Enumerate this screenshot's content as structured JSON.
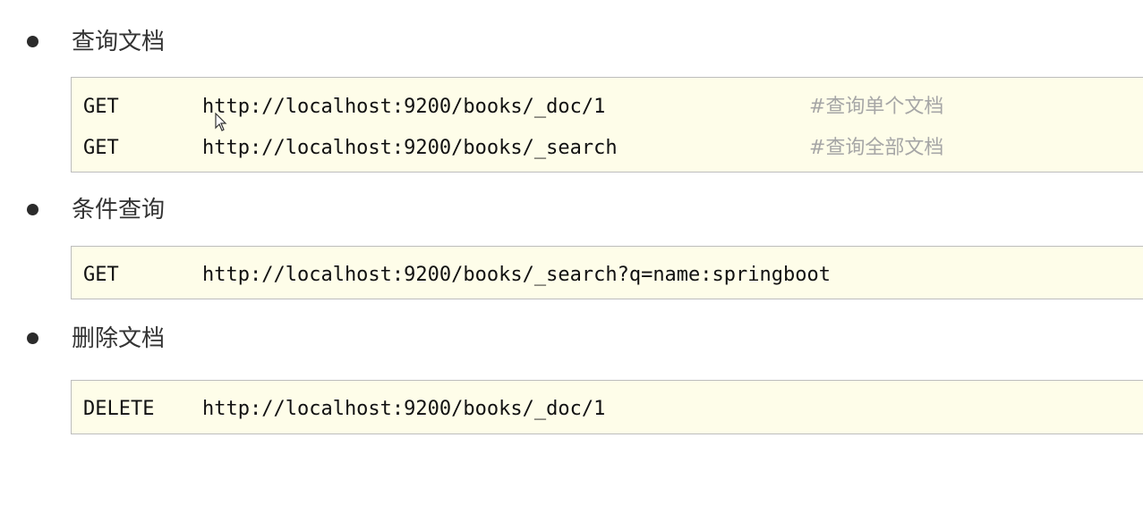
{
  "sections": [
    {
      "heading": "查询文档",
      "rows": [
        {
          "method": "GET",
          "url": "http://localhost:9200/books/_doc/1",
          "comment": "#查询单个文档"
        },
        {
          "method": "GET",
          "url": "http://localhost:9200/books/_search",
          "comment": "#查询全部文档"
        }
      ]
    },
    {
      "heading": "条件查询",
      "rows": [
        {
          "method": "GET",
          "url": "http://localhost:9200/books/_search?q=name:springboot"
        }
      ]
    },
    {
      "heading": "删除文档",
      "rows": [
        {
          "method": "DELETE",
          "url": "http://localhost:9200/books/_doc/1"
        }
      ]
    }
  ],
  "icons": {
    "cursor": "mouse-pointer-icon"
  },
  "colors": {
    "code_background": "#fefde9",
    "comment_text": "#a6a6a6",
    "heading_text": "#333333"
  }
}
